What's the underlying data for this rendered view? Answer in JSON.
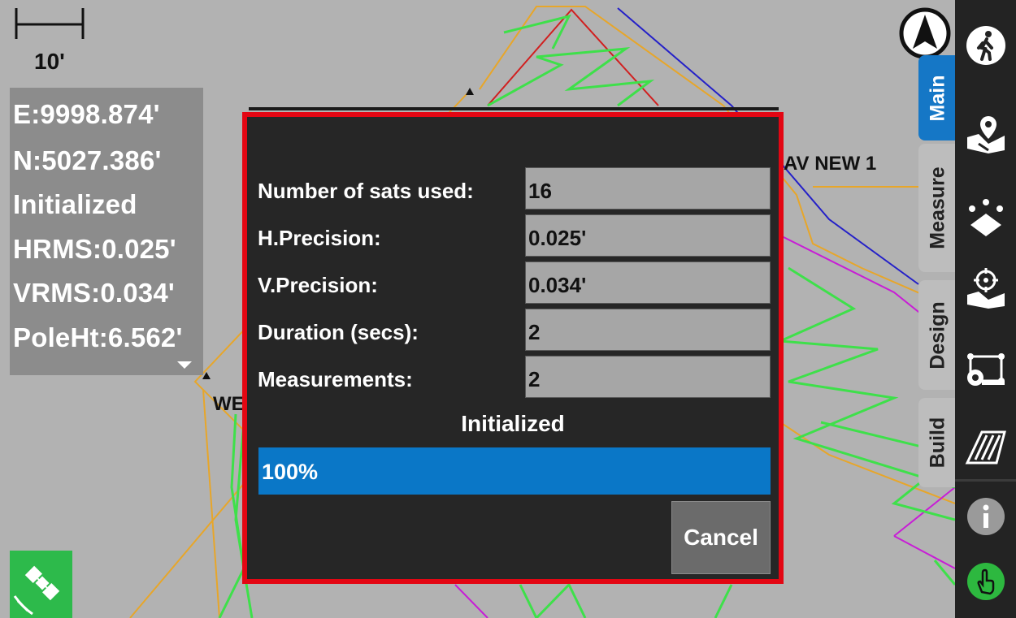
{
  "map": {
    "scale_label": "10'",
    "point_label_1": "AV NEW 1",
    "point_label_2": "WE"
  },
  "status_panel": {
    "lines": [
      "E:9998.874'",
      "N:5027.386'",
      "Initialized",
      "HRMS:0.025'",
      "VRMS:0.034'",
      "PoleHt:6.562'"
    ]
  },
  "tabs": [
    {
      "label": "Main",
      "active": true
    },
    {
      "label": "Measure",
      "active": false
    },
    {
      "label": "Design",
      "active": false
    },
    {
      "label": "Build",
      "active": false
    }
  ],
  "toolbar": {
    "icons": [
      "walking-person-icon",
      "map-pin-icon",
      "stakeout-points-icon",
      "target-map-icon",
      "measure-tape-icon",
      "road-icon",
      "info-icon",
      "touch-hand-icon"
    ]
  },
  "dialog": {
    "fields": [
      {
        "label": "Number of sats used:",
        "value": "16"
      },
      {
        "label": "H.Precision:",
        "value": "0.025'"
      },
      {
        "label": "V.Precision:",
        "value": "0.034'"
      },
      {
        "label": "Duration (secs):",
        "value": "2"
      },
      {
        "label": "Measurements:",
        "value": "2"
      }
    ],
    "status": "Initialized",
    "progress_text": "100%",
    "progress_fraction": 1.0,
    "cancel_label": "Cancel"
  },
  "colors": {
    "accent": "#0a77c7",
    "highlight_border": "#e30613",
    "gps_ok": "#2dba4b"
  }
}
